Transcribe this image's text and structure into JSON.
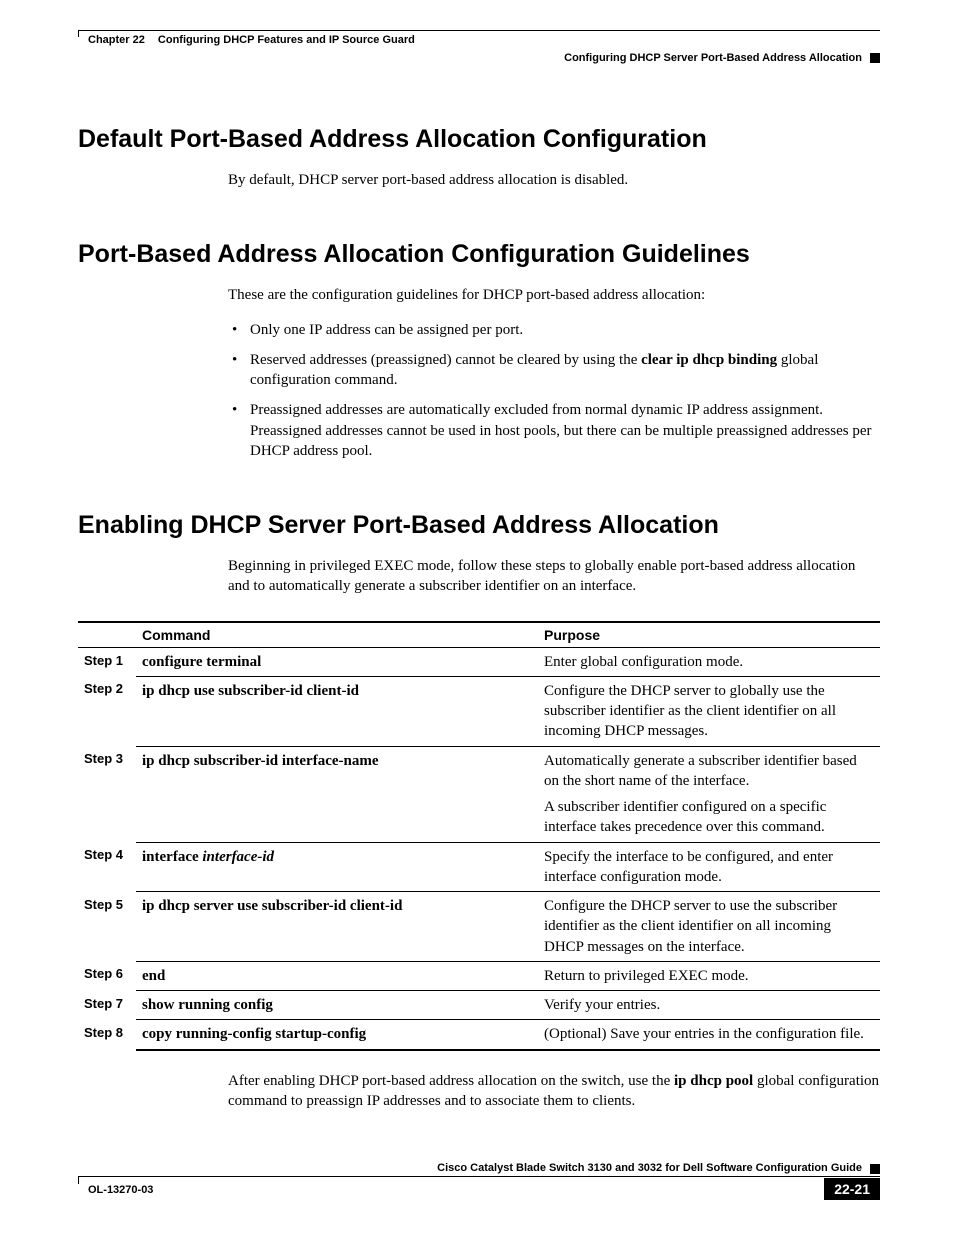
{
  "header": {
    "chapter_num": "Chapter 22",
    "chapter_title": "Configuring DHCP Features and IP Source Guard",
    "section_title": "Configuring DHCP Server Port-Based Address Allocation"
  },
  "section1": {
    "heading": "Default Port-Based Address Allocation Configuration",
    "p1": "By default, DHCP server port-based address allocation is disabled."
  },
  "section2": {
    "heading": "Port-Based Address Allocation Configuration Guidelines",
    "p1": "These are the configuration guidelines for DHCP port-based address allocation:",
    "bullets": [
      "Only one IP address can be assigned per port.",
      "Reserved addresses (preassigned) cannot be cleared by using the ",
      " global configuration command.",
      "Preassigned addresses are automatically excluded from normal dynamic IP address assignment. Preassigned addresses cannot be used in host pools, but there can be multiple preassigned addresses per DHCP address pool."
    ],
    "bold_cmd": "clear ip dhcp binding"
  },
  "section3": {
    "heading": "Enabling DHCP Server Port-Based Address Allocation",
    "p1": "Beginning in privileged EXEC mode, follow these steps to globally enable port-based address allocation and to automatically generate a subscriber identifier on an interface."
  },
  "table": {
    "h_command": "Command",
    "h_purpose": "Purpose",
    "rows": [
      {
        "step": "Step 1",
        "cmd": "configure terminal",
        "cmd_italic": "",
        "purpose": "Enter global configuration mode.",
        "purpose2": ""
      },
      {
        "step": "Step 2",
        "cmd": "ip dhcp use subscriber-id client-id",
        "cmd_italic": "",
        "purpose": "Configure the DHCP server to globally use the subscriber identifier as the client identifier on all incoming DHCP messages.",
        "purpose2": ""
      },
      {
        "step": "Step 3",
        "cmd": "ip dhcp subscriber-id interface-name",
        "cmd_italic": "",
        "purpose": "Automatically generate a subscriber identifier based on the short name of the interface.",
        "purpose2": "A subscriber identifier configured on a specific interface takes precedence over this command."
      },
      {
        "step": "Step 4",
        "cmd": "interface ",
        "cmd_italic": "interface-id",
        "purpose": "Specify the interface to be configured, and enter interface configuration mode.",
        "purpose2": ""
      },
      {
        "step": "Step 5",
        "cmd": "ip dhcp server use subscriber-id client-id",
        "cmd_italic": "",
        "purpose": "Configure the DHCP server to use the subscriber identifier as the client identifier on all incoming DHCP messages on the interface.",
        "purpose2": ""
      },
      {
        "step": "Step 6",
        "cmd": "end",
        "cmd_italic": "",
        "purpose": "Return to privileged EXEC mode.",
        "purpose2": ""
      },
      {
        "step": "Step 7",
        "cmd": "show running config",
        "cmd_italic": "",
        "purpose": "Verify your entries.",
        "purpose2": ""
      },
      {
        "step": "Step 8",
        "cmd": "copy running-config startup-config",
        "cmd_italic": "",
        "purpose": "(Optional) Save your entries in the configuration file.",
        "purpose2": ""
      }
    ]
  },
  "after": {
    "t1": "After enabling DHCP port-based address allocation on the switch, use the ",
    "bold": "ip dhcp pool",
    "t2": " global configuration command to preassign IP addresses and to associate them to clients."
  },
  "footer": {
    "guide": "Cisco Catalyst Blade Switch 3130 and 3032 for Dell Software Configuration Guide",
    "doc_id": "OL-13270-03",
    "page_num": "22-21"
  }
}
